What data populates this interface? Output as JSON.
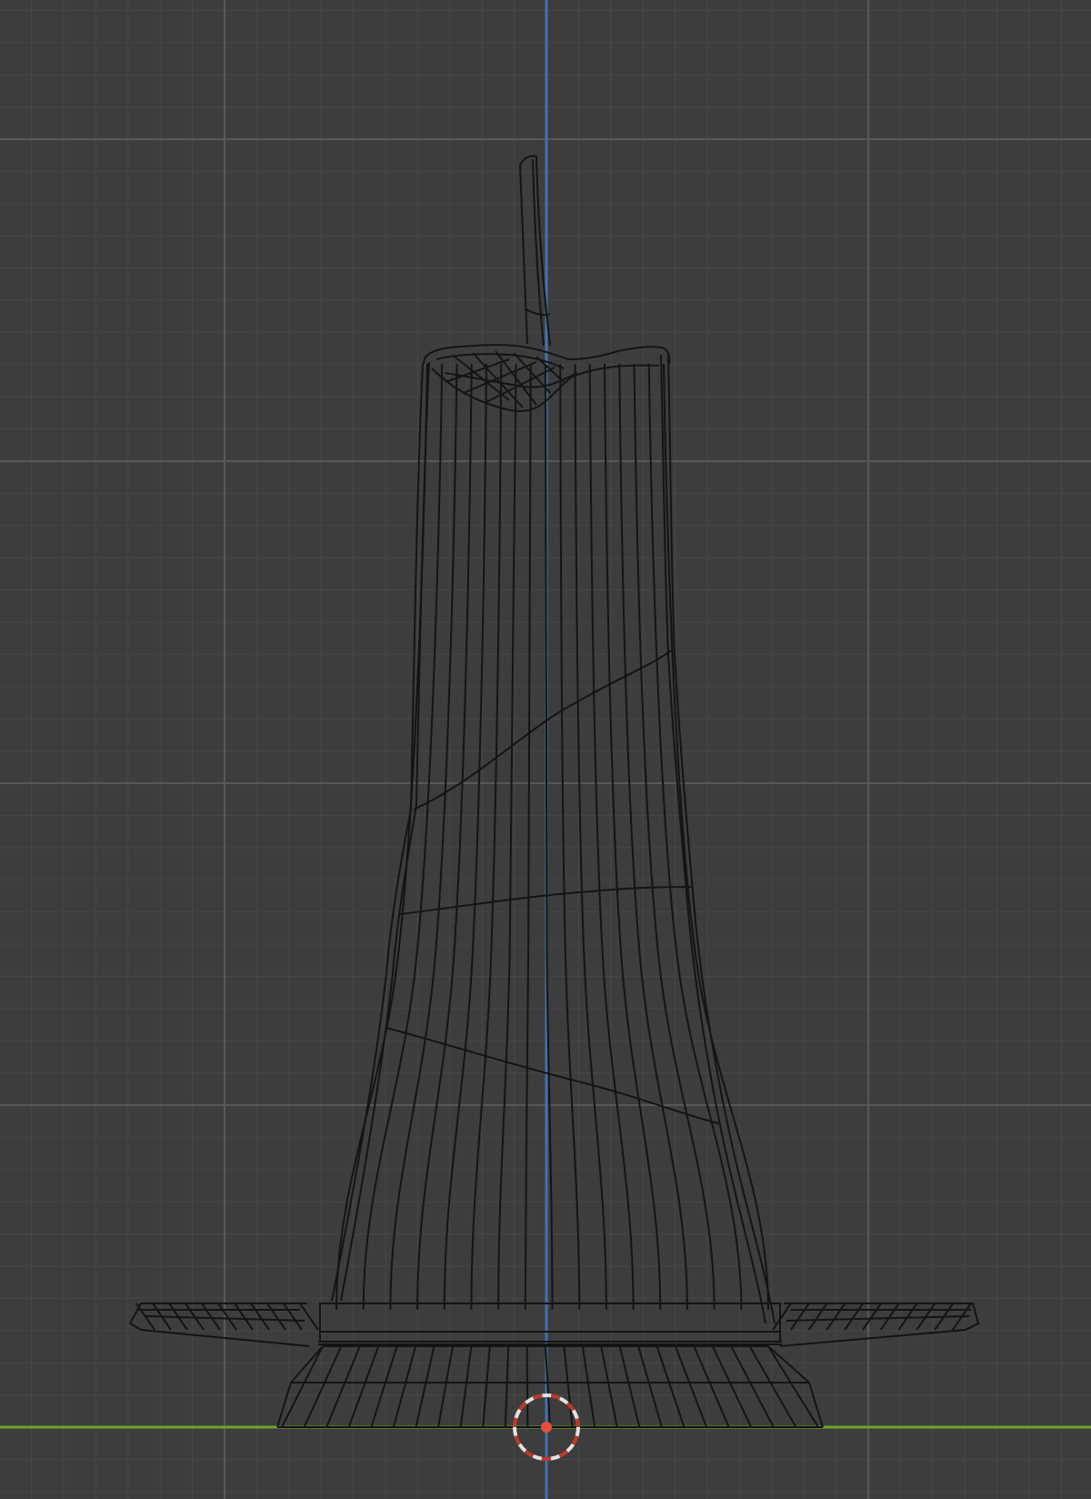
{
  "viewport": {
    "view": "front-orthographic",
    "shading": "wireframe",
    "background_color": "#3d3d3d",
    "grid_minor_color": "#474747",
    "grid_major_color": "#585858",
    "z_axis_color": "#3d73b3",
    "x_axis_color": "#6fa52a",
    "wire_color": "#141414",
    "cursor_ring_colors": [
      "#e3e3e3",
      "#c0392b"
    ],
    "object": "candle-on-holder"
  }
}
